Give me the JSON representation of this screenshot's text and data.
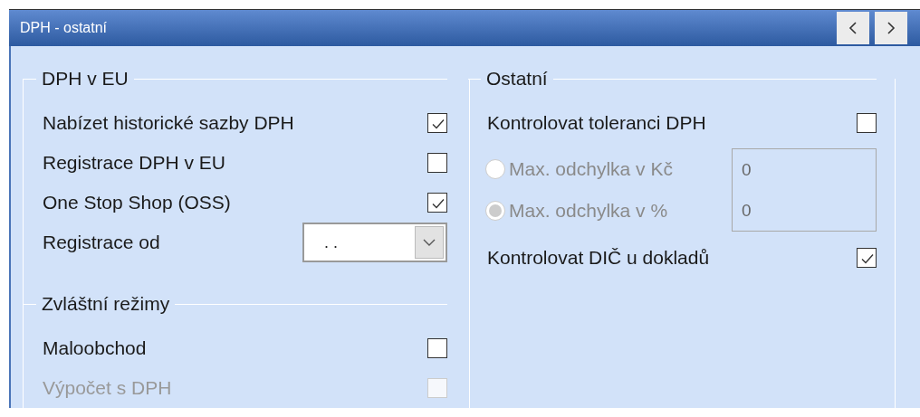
{
  "window": {
    "title": "DPH - ostatní"
  },
  "nav_buttons": [
    {
      "kind": "previous"
    },
    {
      "kind": "next"
    }
  ],
  "vat_eu": {
    "legend": "DPH v EU",
    "rows": [
      {
        "kind": "checkbox",
        "label": "Nabízet historické sazby DPH",
        "checked": true,
        "disabled": false
      },
      {
        "kind": "checkbox",
        "label": "Registrace DPH v EU",
        "checked": false,
        "disabled": false
      },
      {
        "kind": "checkbox",
        "label": "One Stop Shop (OSS)",
        "checked": true,
        "disabled": false
      },
      {
        "kind": "dropdown",
        "label": "Registrace od",
        "value": ". ."
      }
    ]
  },
  "special_modes": {
    "legend": "Zvláštní režimy",
    "rows": [
      {
        "kind": "checkbox",
        "label": "Maloobchod",
        "checked": false,
        "disabled": false
      },
      {
        "kind": "checkbox",
        "label": "Výpočet s DPH",
        "checked": false,
        "disabled": true
      }
    ]
  },
  "other": {
    "legend": "Ostatní",
    "tolerance_check": {
      "label": "Kontrolovat toleranci DPH",
      "checked": false,
      "disabled": false
    },
    "tolerance_options": [
      {
        "label": "Max. odchylka v Kč",
        "selected": false,
        "disabled": true,
        "value": "0"
      },
      {
        "label": "Max. odchylka v %",
        "selected": true,
        "disabled": true,
        "value": "0"
      }
    ],
    "dic_check": {
      "label": "Kontrolovat DIČ u dokladů",
      "checked": true,
      "disabled": false
    }
  }
}
